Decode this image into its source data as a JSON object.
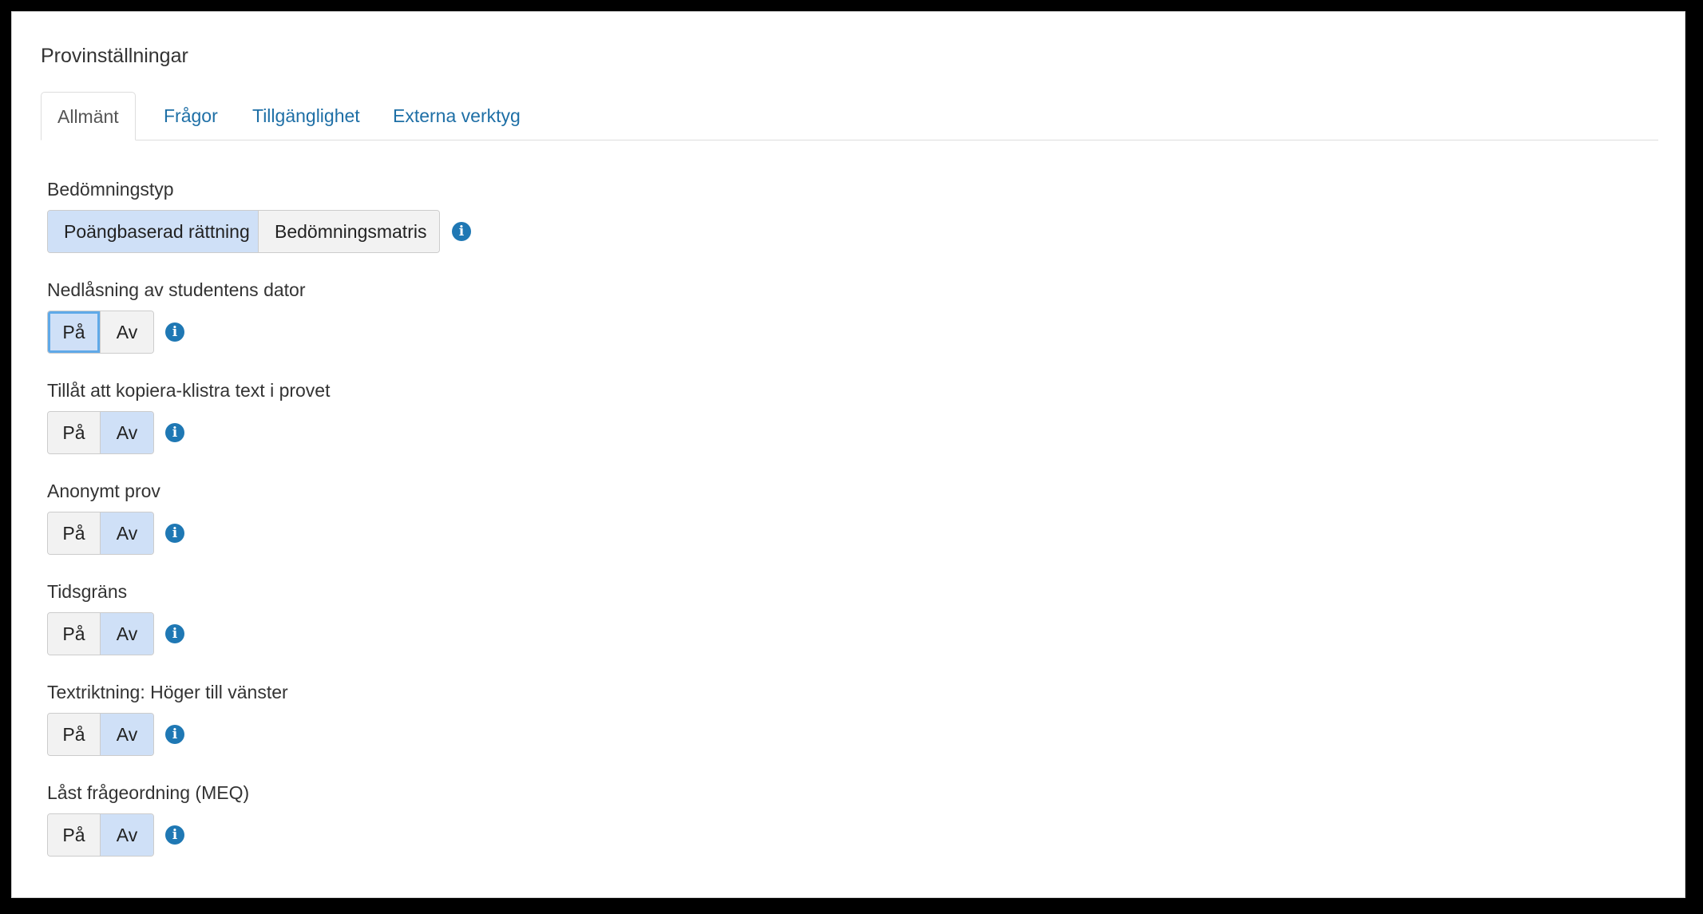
{
  "page": {
    "title": "Provinställningar"
  },
  "tabs": [
    {
      "label": "Allmänt",
      "active": true
    },
    {
      "label": "Frågor",
      "active": false
    },
    {
      "label": "Tillgänglighet",
      "active": false
    },
    {
      "label": "Externa verktyg",
      "active": false
    }
  ],
  "icons": {
    "info": "info-icon",
    "info_glyph": "i"
  },
  "colors": {
    "link": "#1e6fa6",
    "selected_segment": "#cfe0f7",
    "info_icon": "#1f78b4"
  },
  "settings": {
    "grading_type": {
      "label": "Bedömningstyp",
      "options": [
        "Poängbaserad rättning",
        "Bedömningsmatris"
      ],
      "selected": "Poängbaserad rättning"
    },
    "lockdown": {
      "label": "Nedlåsning av studentens dator",
      "options": [
        "På",
        "Av"
      ],
      "selected": "På"
    },
    "copy_paste": {
      "label": "Tillåt att kopiera-klistra text i provet",
      "options": [
        "På",
        "Av"
      ],
      "selected": "Av"
    },
    "anonymous": {
      "label": "Anonymt prov",
      "options": [
        "På",
        "Av"
      ],
      "selected": "Av"
    },
    "time_limit": {
      "label": "Tidsgräns",
      "options": [
        "På",
        "Av"
      ],
      "selected": "Av"
    },
    "rtl": {
      "label": "Textriktning: Höger till vänster",
      "options": [
        "På",
        "Av"
      ],
      "selected": "Av"
    },
    "locked_order": {
      "label": "Låst frågeordning (MEQ)",
      "options": [
        "På",
        "Av"
      ],
      "selected": "Av"
    }
  }
}
